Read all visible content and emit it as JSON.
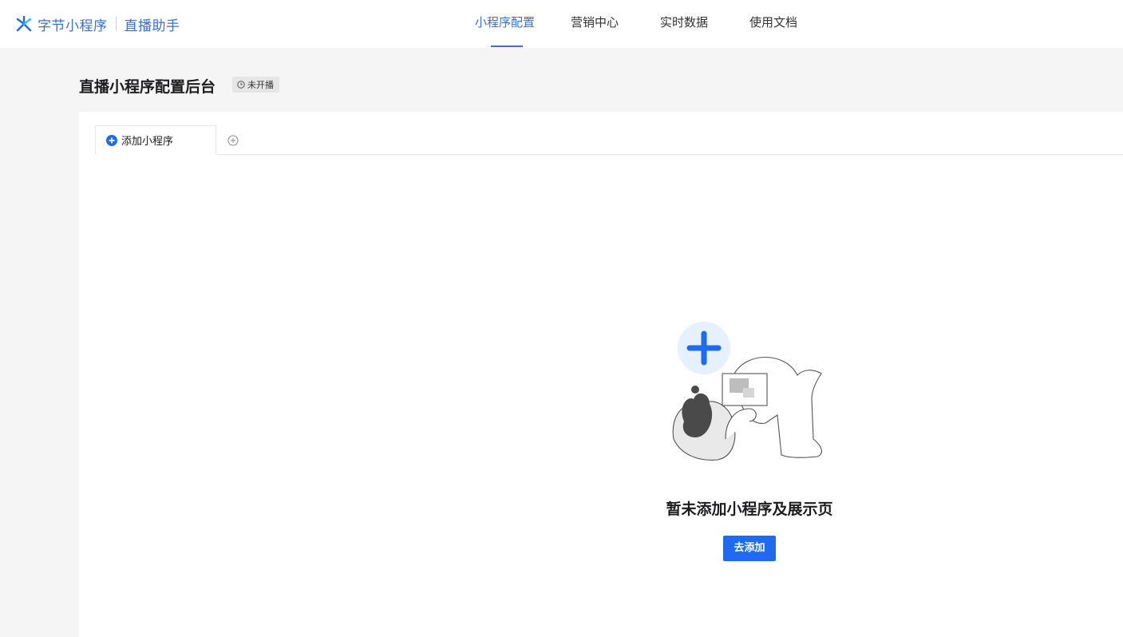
{
  "brand": {
    "name": "字节小程序",
    "sub": "直播助手"
  },
  "nav": {
    "items": [
      {
        "label": "小程序配置",
        "active": true
      },
      {
        "label": "营销中心",
        "active": false
      },
      {
        "label": "实时数据",
        "active": false
      },
      {
        "label": "使用文档",
        "active": false
      }
    ]
  },
  "header": {
    "title": "直播小程序配置后台",
    "status": "未开播"
  },
  "tabs": {
    "items": [
      {
        "label": "添加小程序"
      }
    ]
  },
  "empty": {
    "message": "暂未添加小程序及展示页",
    "button": "去添加"
  },
  "colors": {
    "accent": "#3a6fd8",
    "button": "#1e6bf2",
    "background": "#f5f5f5"
  },
  "icons": {
    "brand": "bytedance-star-icon",
    "status": "clock-icon",
    "tab": "plus-circle-icon",
    "add_tab": "add-circle-icon"
  }
}
